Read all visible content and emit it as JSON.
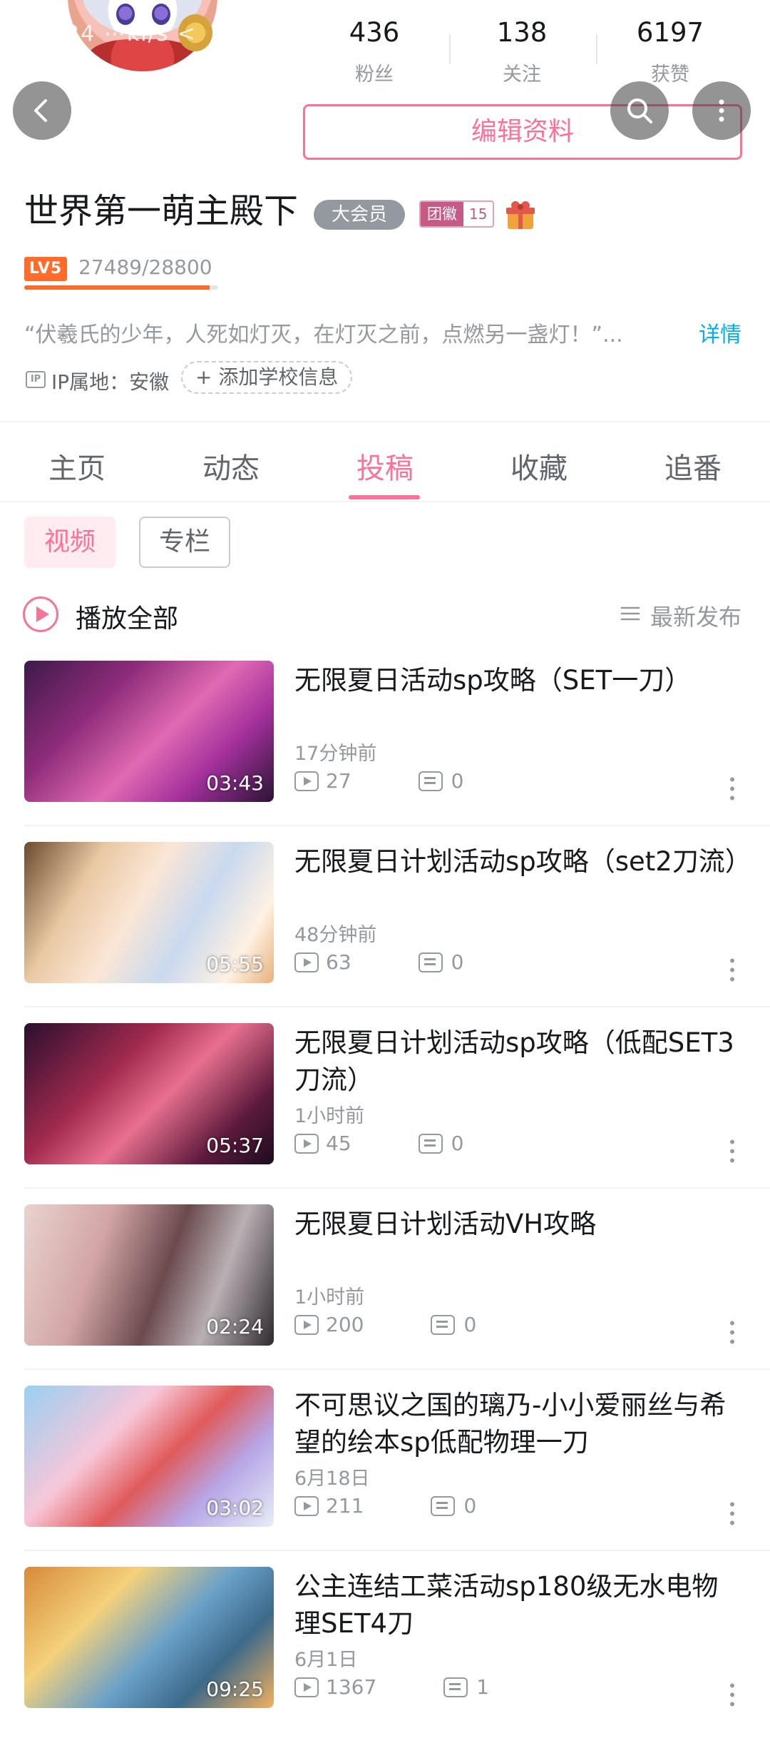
{
  "profile": {
    "avatar_overlay_text": ":24 ⋯ki/s <",
    "stats": [
      {
        "value": "436",
        "label": "粉丝"
      },
      {
        "value": "138",
        "label": "关注"
      },
      {
        "value": "6197",
        "label": "获赞"
      }
    ],
    "edit_label": "编辑资料",
    "username": "世界第一萌主殿下",
    "vip_label": "大会员",
    "fan_badge_label": "团徽",
    "fan_badge_level": "15",
    "level_label": "LV5",
    "exp_text": "27489/28800",
    "exp_progress": 0.9545,
    "sign": "“伏羲氏的少年，人死如灯灭，在灯灭之前，点燃另一盏灯！”...",
    "detail_link": "详情",
    "ip_icon_text": "IP",
    "ip_location": "IP属地：安徽",
    "add_school": "+ 添加学校信息"
  },
  "tabs": [
    {
      "label": "主页",
      "active": false
    },
    {
      "label": "动态",
      "active": false
    },
    {
      "label": "投稿",
      "active": true
    },
    {
      "label": "收藏",
      "active": false
    },
    {
      "label": "追番",
      "active": false
    }
  ],
  "content_filters": [
    {
      "label": "视频",
      "active": true
    },
    {
      "label": "专栏",
      "active": false
    }
  ],
  "play_all_label": "播放全部",
  "sort_label": "最新发布",
  "videos": [
    {
      "title": "无限夏日活动sp攻略（SET一刀）",
      "time": "17分钟前",
      "plays": "27",
      "comments": "0",
      "duration": "03:43"
    },
    {
      "title": "无限夏日计划活动sp攻略（set2刀流）",
      "time": "48分钟前",
      "plays": "63",
      "comments": "0",
      "duration": "05:55"
    },
    {
      "title": "无限夏日计划活动sp攻略（低配SET3刀流）",
      "time": "1小时前",
      "plays": "45",
      "comments": "0",
      "duration": "05:37"
    },
    {
      "title": "无限夏日计划活动VH攻略",
      "time": "1小时前",
      "plays": "200",
      "comments": "0",
      "duration": "02:24"
    },
    {
      "title": "不可思议之国的璃乃-小小爱丽丝与希望的绘本sp低配物理一刀",
      "time": "6月18日",
      "plays": "211",
      "comments": "0",
      "duration": "03:02"
    },
    {
      "title": "公主连结工菜活动sp180级无水电物理SET4刀",
      "time": "6月1日",
      "plays": "1367",
      "comments": "1",
      "duration": "09:25"
    }
  ],
  "colors": {
    "accent": "#fb7299",
    "link": "#00aeec",
    "level": "#ff6b29",
    "muted": "#9499a0"
  }
}
